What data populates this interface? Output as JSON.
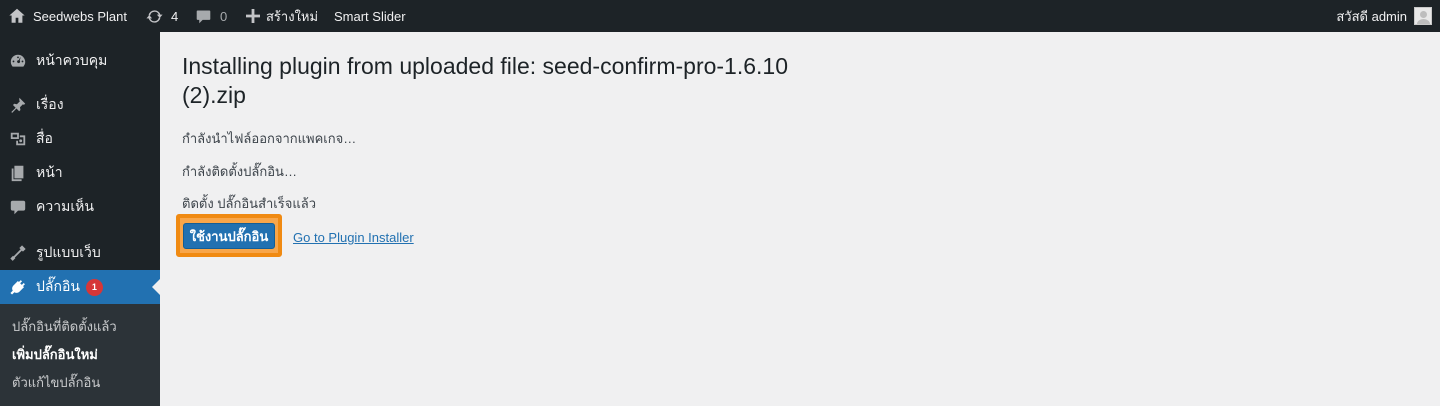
{
  "adminbar": {
    "site_name": "Seedwebs Plant",
    "updates_count": "4",
    "comments_count": "0",
    "new_label": "สร้างใหม่",
    "smart_slider": "Smart Slider",
    "greeting": "สวัสดี admin"
  },
  "sidebar": {
    "items": [
      {
        "label": "หน้าควบคุม",
        "icon": "dashboard-icon"
      },
      {
        "label": "เรื่อง",
        "icon": "pin-icon"
      },
      {
        "label": "สื่อ",
        "icon": "media-icon"
      },
      {
        "label": "หน้า",
        "icon": "pages-icon"
      },
      {
        "label": "ความเห็น",
        "icon": "comment-icon"
      },
      {
        "label": "รูปแบบเว็บ",
        "icon": "appearance-icon"
      },
      {
        "label": "ปลั๊กอิน",
        "icon": "plugins-icon",
        "badge": "1"
      }
    ],
    "submenu": [
      {
        "label": "ปลั๊กอินที่ติดตั้งแล้ว"
      },
      {
        "label": "เพิ่มปลั๊กอินใหม่"
      },
      {
        "label": "ตัวแก้ไขปลั๊กอิน"
      }
    ]
  },
  "main": {
    "title": "Installing plugin from uploaded file: seed-confirm-pro-1.6.10 (2).zip",
    "messages": [
      "กำลังนำไฟล์ออกจากแพคเกจ…",
      "กำลังติดตั้งปลั๊กอิน…",
      "ติดตั้ง ปลั๊กอินสำเร็จแล้ว"
    ],
    "activate_button": "ใช้งานปลั๊กอิน",
    "installer_link": "Go to Plugin Installer"
  },
  "colors": {
    "adminbar_bg": "#1d2327",
    "current_menu_bg": "#2271b1",
    "highlight_outline": "#f08a12",
    "badge": "#d63638"
  }
}
